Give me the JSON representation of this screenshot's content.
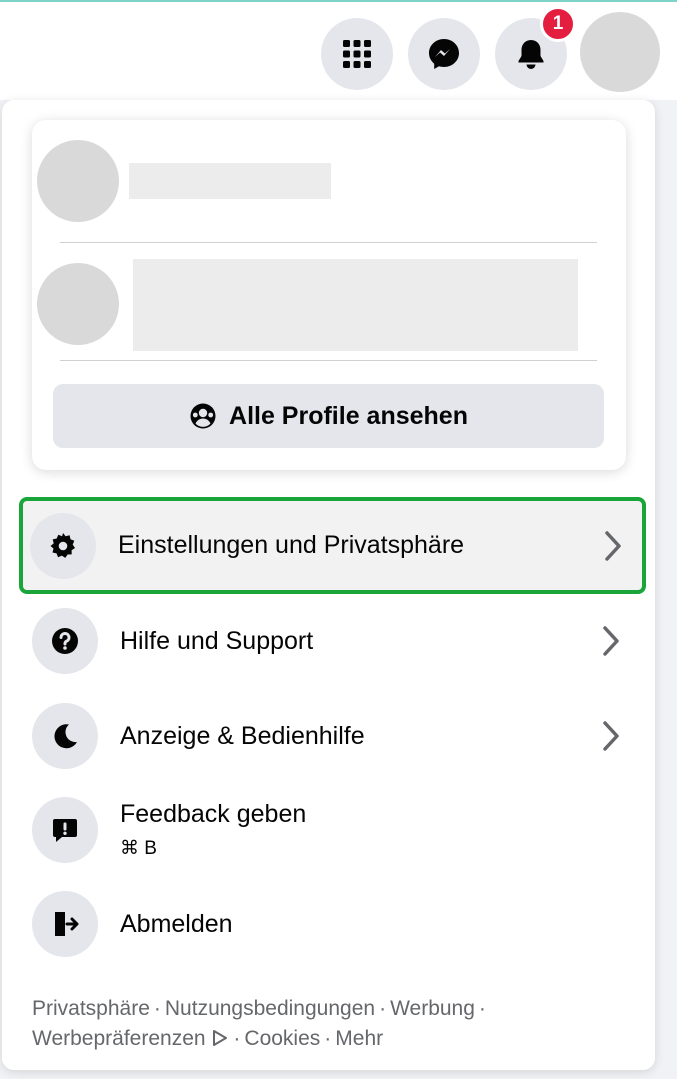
{
  "topbar": {
    "notification_count": "1",
    "icons": [
      "menu-grid-icon",
      "messenger-icon",
      "bell-icon"
    ]
  },
  "profiles": {
    "all_profiles_label": "Alle Profile ansehen"
  },
  "menu": {
    "items": [
      {
        "label": "Einstellungen und Privatsphäre",
        "icon": "gear-icon"
      },
      {
        "label": "Hilfe und Support",
        "icon": "question-icon"
      },
      {
        "label": "Anzeige & Bedienhilfe",
        "icon": "moon-icon"
      },
      {
        "label": "Feedback geben",
        "sublabel": "⌘ B",
        "icon": "feedback-icon"
      },
      {
        "label": "Abmelden",
        "icon": "logout-icon"
      }
    ]
  },
  "footer": {
    "links": [
      "Privatsphäre",
      "Nutzungsbedingungen",
      "Werbung",
      "Werbepräferenzen",
      "Cookies",
      "Mehr"
    ],
    "separator": "·"
  },
  "colors": {
    "highlight_border": "#19a53a",
    "badge": "#e41e3f",
    "icon_bg": "#e4e6eb"
  }
}
